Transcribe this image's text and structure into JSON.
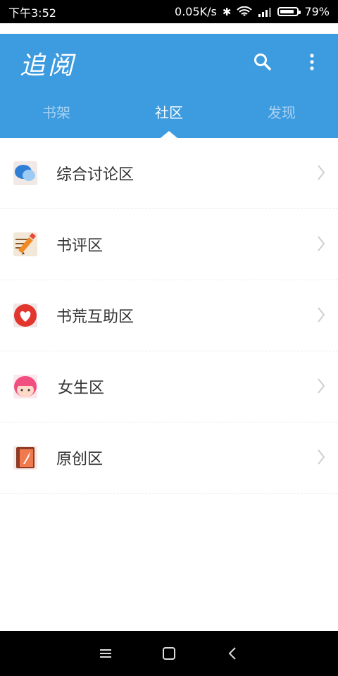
{
  "status_bar": {
    "time": "下午3:52",
    "network_speed": "0.05K/s",
    "battery": "79%",
    "battery_level": 0.79
  },
  "app": {
    "title": "追阅",
    "accent_color": "#3d9be0"
  },
  "tabs": [
    {
      "label": "书架",
      "active": false
    },
    {
      "label": "社区",
      "active": true
    },
    {
      "label": "发现",
      "active": false
    }
  ],
  "community_items": [
    {
      "label": "综合讨论区",
      "icon": "chat-bubbles-icon"
    },
    {
      "label": "书评区",
      "icon": "pencil-note-icon"
    },
    {
      "label": "书荒互助区",
      "icon": "heart-icon"
    },
    {
      "label": "女生区",
      "icon": "girl-face-icon"
    },
    {
      "label": "原创区",
      "icon": "book-quill-icon"
    }
  ]
}
